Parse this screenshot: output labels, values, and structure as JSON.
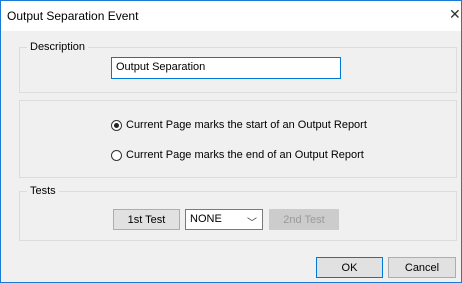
{
  "window": {
    "title": "Output Separation Event",
    "close_glyph": "✕"
  },
  "description": {
    "legend": "Description",
    "value": "Output Separation"
  },
  "mode": {
    "options": [
      {
        "label": "Current Page marks the start of an Output Report",
        "checked": true
      },
      {
        "label": "Current Page marks the end of an Output Report",
        "checked": false
      }
    ]
  },
  "tests": {
    "legend": "Tests",
    "first_test_label": "1st Test",
    "select_value": "NONE",
    "second_test_label": "2nd Test"
  },
  "footer": {
    "ok_label": "OK",
    "cancel_label": "Cancel"
  },
  "colors": {
    "accent": "#0078d7",
    "disabled": "#9a9a9a"
  }
}
